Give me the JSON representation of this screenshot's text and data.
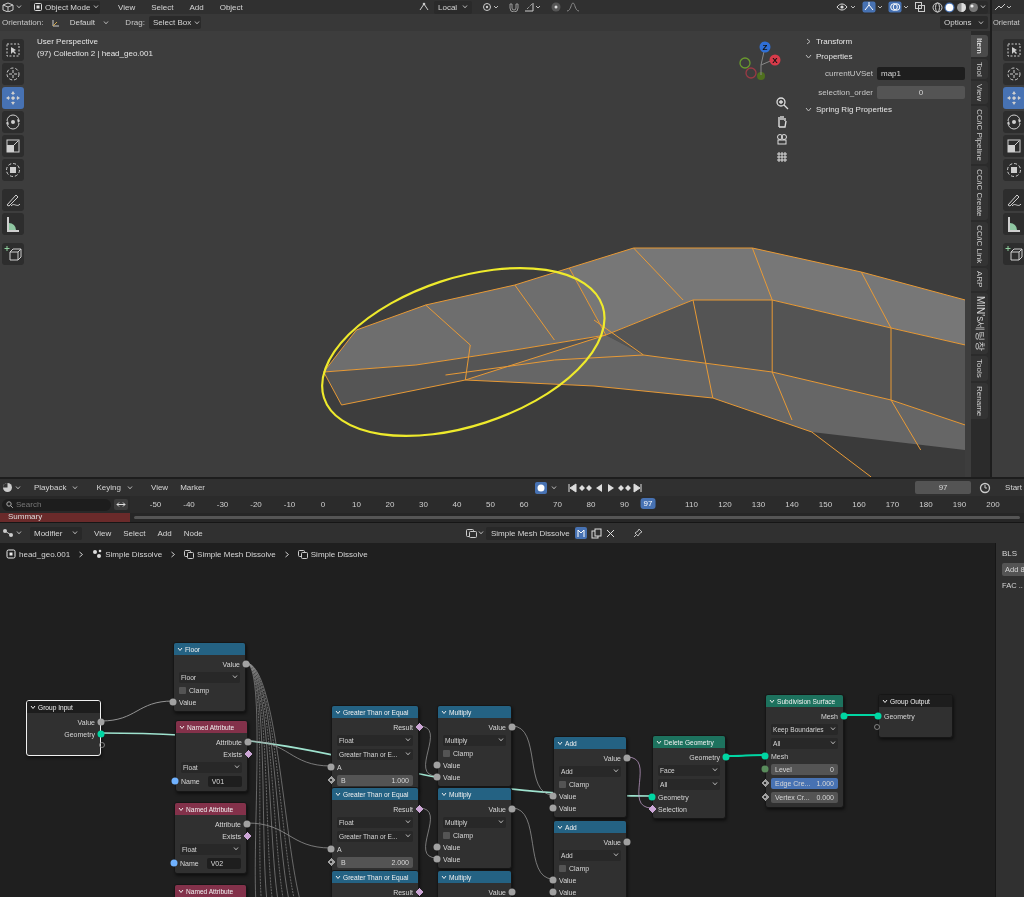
{
  "viewport_header": {
    "mode": "Object Mode",
    "menus": [
      "View",
      "Select",
      "Add",
      "Object"
    ],
    "transform_pivot": "Local"
  },
  "tool_settings": {
    "orientation_label": "Orientation:",
    "orientation": "Default",
    "drag_label": "Drag:",
    "drag": "Select Box",
    "options": "Options"
  },
  "side_editor": {
    "clipped_label": "Orientat",
    "tools": [
      {
        "kind": "select",
        "selected": false
      },
      {
        "kind": "cursor",
        "selected": false
      },
      {
        "kind": "move",
        "selected": true
      },
      {
        "kind": "rotate",
        "selected": false
      },
      {
        "kind": "scale",
        "selected": false
      },
      {
        "kind": "transform",
        "selected": false
      },
      {
        "kind": "annotate",
        "selected": false
      },
      {
        "kind": "measure",
        "selected": false
      },
      {
        "kind": "add_cube",
        "selected": false
      }
    ]
  },
  "viewport": {
    "view_name": "User Perspective",
    "object_info": "(97) Collection 2 | head_geo.001",
    "axis_labels": [
      "Z",
      "X"
    ],
    "tools": [
      {
        "kind": "select",
        "selected": false
      },
      {
        "kind": "cursor",
        "selected": false
      },
      {
        "kind": "move",
        "selected": true
      },
      {
        "kind": "rotate",
        "selected": false
      },
      {
        "kind": "scale",
        "selected": false
      },
      {
        "kind": "transform",
        "selected": false
      },
      {
        "kind": "annotate",
        "selected": false
      },
      {
        "kind": "measure",
        "selected": false
      },
      {
        "kind": "add_cube",
        "selected": false
      }
    ]
  },
  "sidebar": {
    "panels": [
      {
        "title": "Transform",
        "expanded": false
      },
      {
        "title": "Properties",
        "expanded": true,
        "fields": [
          {
            "label": "currentUVSet",
            "value": "map1",
            "kind": "text"
          },
          {
            "label": "selection_order",
            "value": "0",
            "kind": "number"
          }
        ]
      },
      {
        "title": "Spring Rig Properties",
        "expanded": true
      }
    ],
    "tabs": [
      {
        "label": "Item",
        "selected": true
      },
      {
        "label": "Tool",
        "selected": false
      },
      {
        "label": "View",
        "selected": false
      },
      {
        "label": "CC/iC Pipeline",
        "selected": false
      },
      {
        "label": "CC/iC Create",
        "selected": false
      },
      {
        "label": "CC/iC Link",
        "selected": false
      },
      {
        "label": "ARP",
        "selected": false
      },
      {
        "label": "MIN's세팅창",
        "selected": false
      },
      {
        "label": "Tools",
        "selected": false
      },
      {
        "label": "Rename",
        "selected": false
      }
    ]
  },
  "timeline": {
    "menus": [
      {
        "label": "Playback",
        "kind": "dropdown"
      },
      {
        "label": "Keying",
        "kind": "dropdown"
      },
      {
        "label": "View",
        "kind": "menu"
      },
      {
        "label": "Marker",
        "kind": "menu"
      }
    ],
    "auto_keying": true,
    "current_frame": "97",
    "start_label": "Start",
    "search_placeholder": "Search",
    "frames": [
      "-50",
      "-40",
      "-30",
      "-20",
      "-10",
      "0",
      "10",
      "20",
      "30",
      "40",
      "50",
      "60",
      "70",
      "80",
      "90",
      "110",
      "120",
      "130",
      "140",
      "150",
      "160",
      "170",
      "180",
      "190",
      "200"
    ],
    "playhead": "97",
    "channel": "Summary"
  },
  "node_editor": {
    "editor_type": "Modifier",
    "menus": [
      "View",
      "Select",
      "Add",
      "Node"
    ],
    "node_group": "Simple Mesh Dissolve",
    "breadcrumbs": [
      {
        "label": "head_geo.001",
        "kind": "object"
      },
      {
        "label": "Simple Dissolve",
        "kind": "modifier"
      },
      {
        "label": "Simple Mesh Dissolve",
        "kind": "node_group"
      },
      {
        "label": "Simple Dissolve",
        "kind": "node_group"
      }
    ],
    "nodes": [
      {
        "title": "Group Input",
        "kind": "group",
        "selected": true,
        "rows": [
          {
            "kind": "output",
            "label": "Value",
            "socket": {
              "kind": "circle",
              "color": "#a1a1a1"
            }
          },
          {
            "kind": "output",
            "label": "Geometry",
            "socket": {
              "kind": "circle",
              "color": "#00d6a3"
            }
          },
          {
            "kind": "virtual_output"
          }
        ]
      },
      {
        "title": "Floor",
        "kind": "math",
        "selected": false,
        "rows": [
          {
            "kind": "output",
            "label": "Value",
            "socket": {
              "kind": "circle",
              "color": "#a1a1a1"
            }
          },
          {
            "kind": "dropdown",
            "value": "Floor"
          },
          {
            "kind": "checkbox",
            "label": "Clamp",
            "checked": false
          },
          {
            "kind": "input",
            "label": "Value",
            "socket": {
              "kind": "circle",
              "color": "#a1a1a1"
            }
          }
        ]
      },
      {
        "title": "Named Attribute",
        "kind": "attribute",
        "selected": false,
        "rows": [
          {
            "kind": "output",
            "label": "Attribute",
            "socket": {
              "kind": "circle",
              "color": "#a1a1a1"
            }
          },
          {
            "kind": "output",
            "label": "Exists",
            "socket": {
              "kind": "diamond",
              "color": "#cca6d6"
            }
          },
          {
            "kind": "dropdown",
            "value": "Float"
          },
          {
            "kind": "text_field",
            "label": "Name",
            "value": "V01",
            "socket": {
              "kind": "circle",
              "color": "#70b2ff"
            }
          }
        ]
      },
      {
        "title": "Named Attribute",
        "kind": "attribute",
        "selected": false,
        "rows": [
          {
            "kind": "output",
            "label": "Attribute",
            "socket": {
              "kind": "circle",
              "color": "#a1a1a1"
            }
          },
          {
            "kind": "output",
            "label": "Exists",
            "socket": {
              "kind": "diamond",
              "color": "#cca6d6"
            }
          },
          {
            "kind": "dropdown",
            "value": "Float"
          },
          {
            "kind": "text_field",
            "label": "Name",
            "value": "V02",
            "socket": {
              "kind": "circle",
              "color": "#70b2ff"
            }
          }
        ]
      },
      {
        "title": "Named Attribute",
        "kind": "attribute",
        "selected": false
      },
      {
        "title": "Greater Than or Equal",
        "kind": "math",
        "selected": false,
        "rows": [
          {
            "kind": "output",
            "label": "Result",
            "socket": {
              "kind": "diamond",
              "color": "#cca6d6"
            }
          },
          {
            "kind": "dropdown",
            "value": "Float"
          },
          {
            "kind": "dropdown",
            "value": "Greater Than or E..."
          },
          {
            "kind": "input",
            "label": "A",
            "socket": {
              "kind": "circle",
              "color": "#a1a1a1"
            }
          },
          {
            "kind": "field",
            "label": "B",
            "value": "1.000",
            "socket": {
              "kind": "hollow_diamond",
              "color": "#a1a1a1"
            },
            "selected": false
          }
        ]
      },
      {
        "title": "Greater Than or Equal",
        "kind": "math",
        "selected": false,
        "rows": [
          {
            "kind": "output",
            "label": "Result",
            "socket": {
              "kind": "diamond",
              "color": "#cca6d6"
            }
          },
          {
            "kind": "dropdown",
            "value": "Float"
          },
          {
            "kind": "dropdown",
            "value": "Greater Than or E..."
          },
          {
            "kind": "input",
            "label": "A",
            "socket": {
              "kind": "circle",
              "color": "#a1a1a1"
            }
          },
          {
            "kind": "field",
            "label": "B",
            "value": "2.000",
            "socket": {
              "kind": "hollow_diamond",
              "color": "#a1a1a1"
            },
            "selected": false
          }
        ]
      },
      {
        "title": "Greater Than or Equal",
        "kind": "math",
        "selected": false,
        "rows": [
          {
            "kind": "output",
            "label": "Result",
            "socket": {
              "kind": "diamond",
              "color": "#cca6d6"
            }
          }
        ]
      },
      {
        "title": "Multiply",
        "kind": "math",
        "selected": false,
        "rows": [
          {
            "kind": "output",
            "label": "Value",
            "socket": {
              "kind": "circle",
              "color": "#a1a1a1"
            }
          },
          {
            "kind": "dropdown",
            "value": "Multiply"
          },
          {
            "kind": "checkbox",
            "label": "Clamp",
            "checked": false
          },
          {
            "kind": "input",
            "label": "Value",
            "socket": {
              "kind": "circle",
              "color": "#a1a1a1"
            }
          },
          {
            "kind": "input",
            "label": "Value",
            "socket": {
              "kind": "circle",
              "color": "#a1a1a1"
            }
          }
        ]
      },
      {
        "title": "Multiply",
        "kind": "math",
        "selected": false,
        "rows": [
          {
            "kind": "output",
            "label": "Value",
            "socket": {
              "kind": "circle",
              "color": "#a1a1a1"
            }
          },
          {
            "kind": "dropdown",
            "value": "Multiply"
          },
          {
            "kind": "checkbox",
            "label": "Clamp",
            "checked": false
          },
          {
            "kind": "input",
            "label": "Value",
            "socket": {
              "kind": "circle",
              "color": "#a1a1a1"
            }
          },
          {
            "kind": "input",
            "label": "Value",
            "socket": {
              "kind": "circle",
              "color": "#a1a1a1"
            }
          }
        ]
      },
      {
        "title": "Multiply",
        "kind": "math",
        "selected": false,
        "rows": [
          {
            "kind": "output",
            "label": "Value",
            "socket": {
              "kind": "circle",
              "color": "#a1a1a1"
            }
          }
        ]
      },
      {
        "title": "Add",
        "kind": "math",
        "selected": false,
        "rows": [
          {
            "kind": "output",
            "label": "Value",
            "socket": {
              "kind": "circle",
              "color": "#a1a1a1"
            }
          },
          {
            "kind": "dropdown",
            "value": "Add"
          },
          {
            "kind": "checkbox",
            "label": "Clamp",
            "checked": false
          },
          {
            "kind": "input",
            "label": "Value",
            "socket": {
              "kind": "circle",
              "color": "#a1a1a1"
            }
          },
          {
            "kind": "input",
            "label": "Value",
            "socket": {
              "kind": "circle",
              "color": "#a1a1a1"
            }
          }
        ]
      },
      {
        "title": "Add",
        "kind": "math",
        "selected": false,
        "rows": [
          {
            "kind": "output",
            "label": "Value",
            "socket": {
              "kind": "circle",
              "color": "#a1a1a1"
            }
          },
          {
            "kind": "dropdown",
            "value": "Add"
          },
          {
            "kind": "checkbox",
            "label": "Clamp",
            "checked": false
          },
          {
            "kind": "input",
            "label": "Value",
            "socket": {
              "kind": "circle",
              "color": "#a1a1a1"
            }
          },
          {
            "kind": "input",
            "label": "Value",
            "socket": {
              "kind": "circle",
              "color": "#a1a1a1"
            }
          }
        ]
      },
      {
        "title": "Delete Geometry",
        "kind": "geometry",
        "selected": false,
        "rows": [
          {
            "kind": "output",
            "label": "Geometry",
            "socket": {
              "kind": "circle",
              "color": "#00d6a3"
            }
          },
          {
            "kind": "dropdown",
            "value": "Face"
          },
          {
            "kind": "dropdown",
            "value": "All"
          },
          {
            "kind": "input",
            "label": "Geometry",
            "socket": {
              "kind": "circle",
              "color": "#00d6a3"
            }
          },
          {
            "kind": "input",
            "label": "Selection",
            "socket": {
              "kind": "diamond",
              "color": "#cca6d6"
            }
          }
        ]
      },
      {
        "title": "Subdivision Surface",
        "kind": "geometry",
        "selected": false,
        "rows": [
          {
            "kind": "output",
            "label": "Mesh",
            "socket": {
              "kind": "circle",
              "color": "#00d6a3"
            }
          },
          {
            "kind": "dropdown",
            "value": "Keep Boundaries"
          },
          {
            "kind": "dropdown",
            "value": "All"
          },
          {
            "kind": "input",
            "label": "Mesh",
            "socket": {
              "kind": "circle",
              "color": "#00d6a3"
            }
          },
          {
            "kind": "field",
            "label": "Level",
            "value": "0",
            "socket": {
              "kind": "circle",
              "color": "#598c5c"
            },
            "selected": false
          },
          {
            "kind": "field",
            "label": "Edge Cre...",
            "value": "1.000",
            "socket": {
              "kind": "hollow_diamond",
              "color": "#a1a1a1"
            },
            "selected": true
          },
          {
            "kind": "field",
            "label": "Vertex Cr...",
            "value": "0.000",
            "socket": {
              "kind": "hollow_diamond",
              "color": "#a1a1a1"
            },
            "selected": false
          }
        ]
      },
      {
        "title": "Group Output",
        "kind": "group",
        "selected": false,
        "rows": [
          {
            "kind": "input",
            "label": "Geometry",
            "socket": {
              "kind": "circle",
              "color": "#00d6a3"
            }
          },
          {
            "kind": "virtual_input"
          }
        ]
      }
    ],
    "side_panel": {
      "tab": "BLS",
      "button": "Add 8",
      "label": "FAC .."
    }
  }
}
